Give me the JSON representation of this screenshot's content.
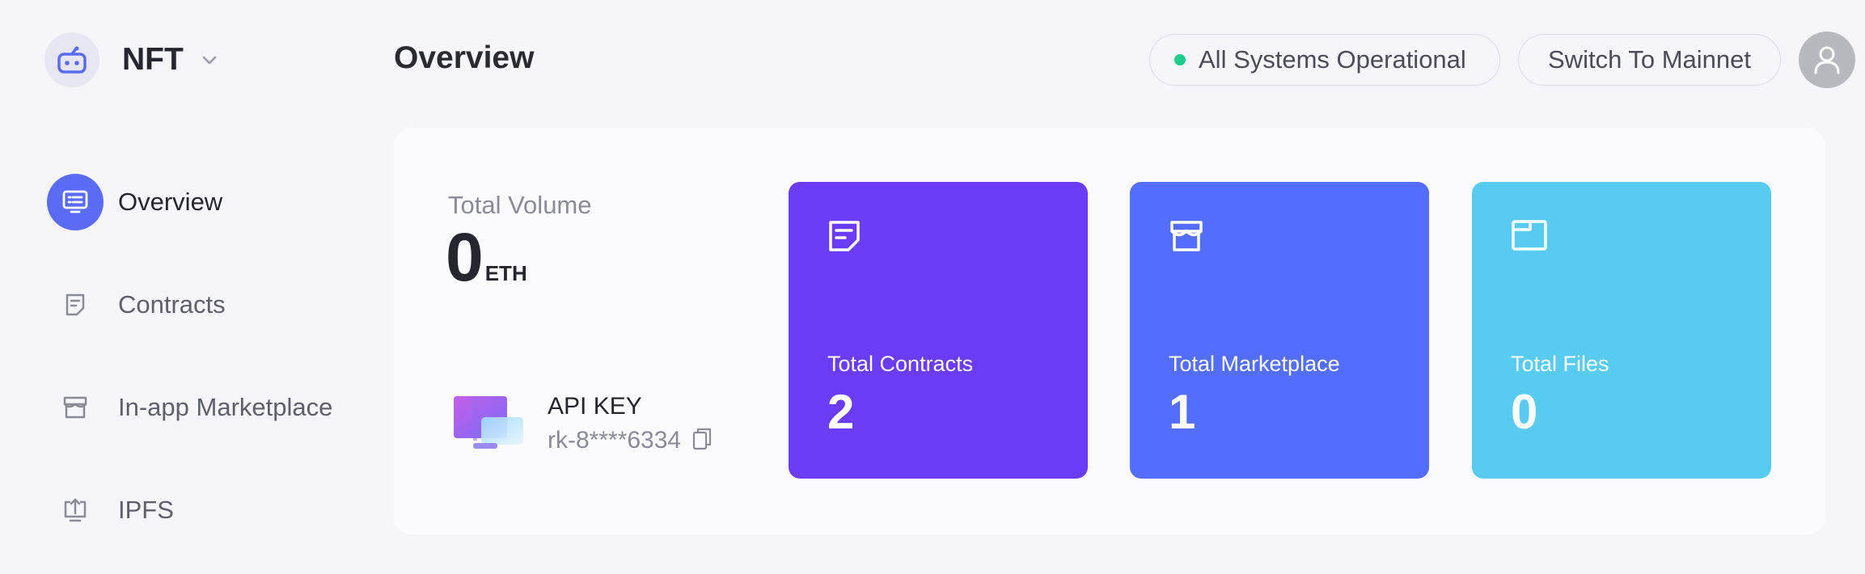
{
  "brand": {
    "name": "NFT",
    "logo_icon": "robot-icon",
    "chevron_icon": "chevron-down-icon"
  },
  "sidebar": {
    "items": [
      {
        "label": "Overview",
        "icon": "monitor-icon",
        "active": true
      },
      {
        "label": "Contracts",
        "icon": "document-icon",
        "active": false
      },
      {
        "label": "In-app Marketplace",
        "icon": "store-icon",
        "active": false
      },
      {
        "label": "IPFS",
        "icon": "upload-icon",
        "active": false
      }
    ]
  },
  "header": {
    "title": "Overview",
    "status_text": "All Systems Operational",
    "status_color": "#1fcc8b",
    "network_button": "Switch To Mainnet",
    "avatar_icon": "user-icon"
  },
  "main": {
    "volume": {
      "label": "Total Volume",
      "value": "0",
      "unit": "ETH"
    },
    "api": {
      "title": "API KEY",
      "key": "rk-8****6334",
      "copy_icon": "copy-icon"
    },
    "stats": [
      {
        "label": "Total Contracts",
        "value": "2",
        "color": "#6b3cf5",
        "icon": "document-icon"
      },
      {
        "label": "Total Marketplace",
        "value": "1",
        "color": "#536dfc",
        "icon": "store-icon"
      },
      {
        "label": "Total Files",
        "value": "0",
        "color": "#58ccf0",
        "icon": "folder-icon"
      }
    ]
  },
  "colors": {
    "accent": "#5a6cf5",
    "background": "#f5f5fa"
  }
}
